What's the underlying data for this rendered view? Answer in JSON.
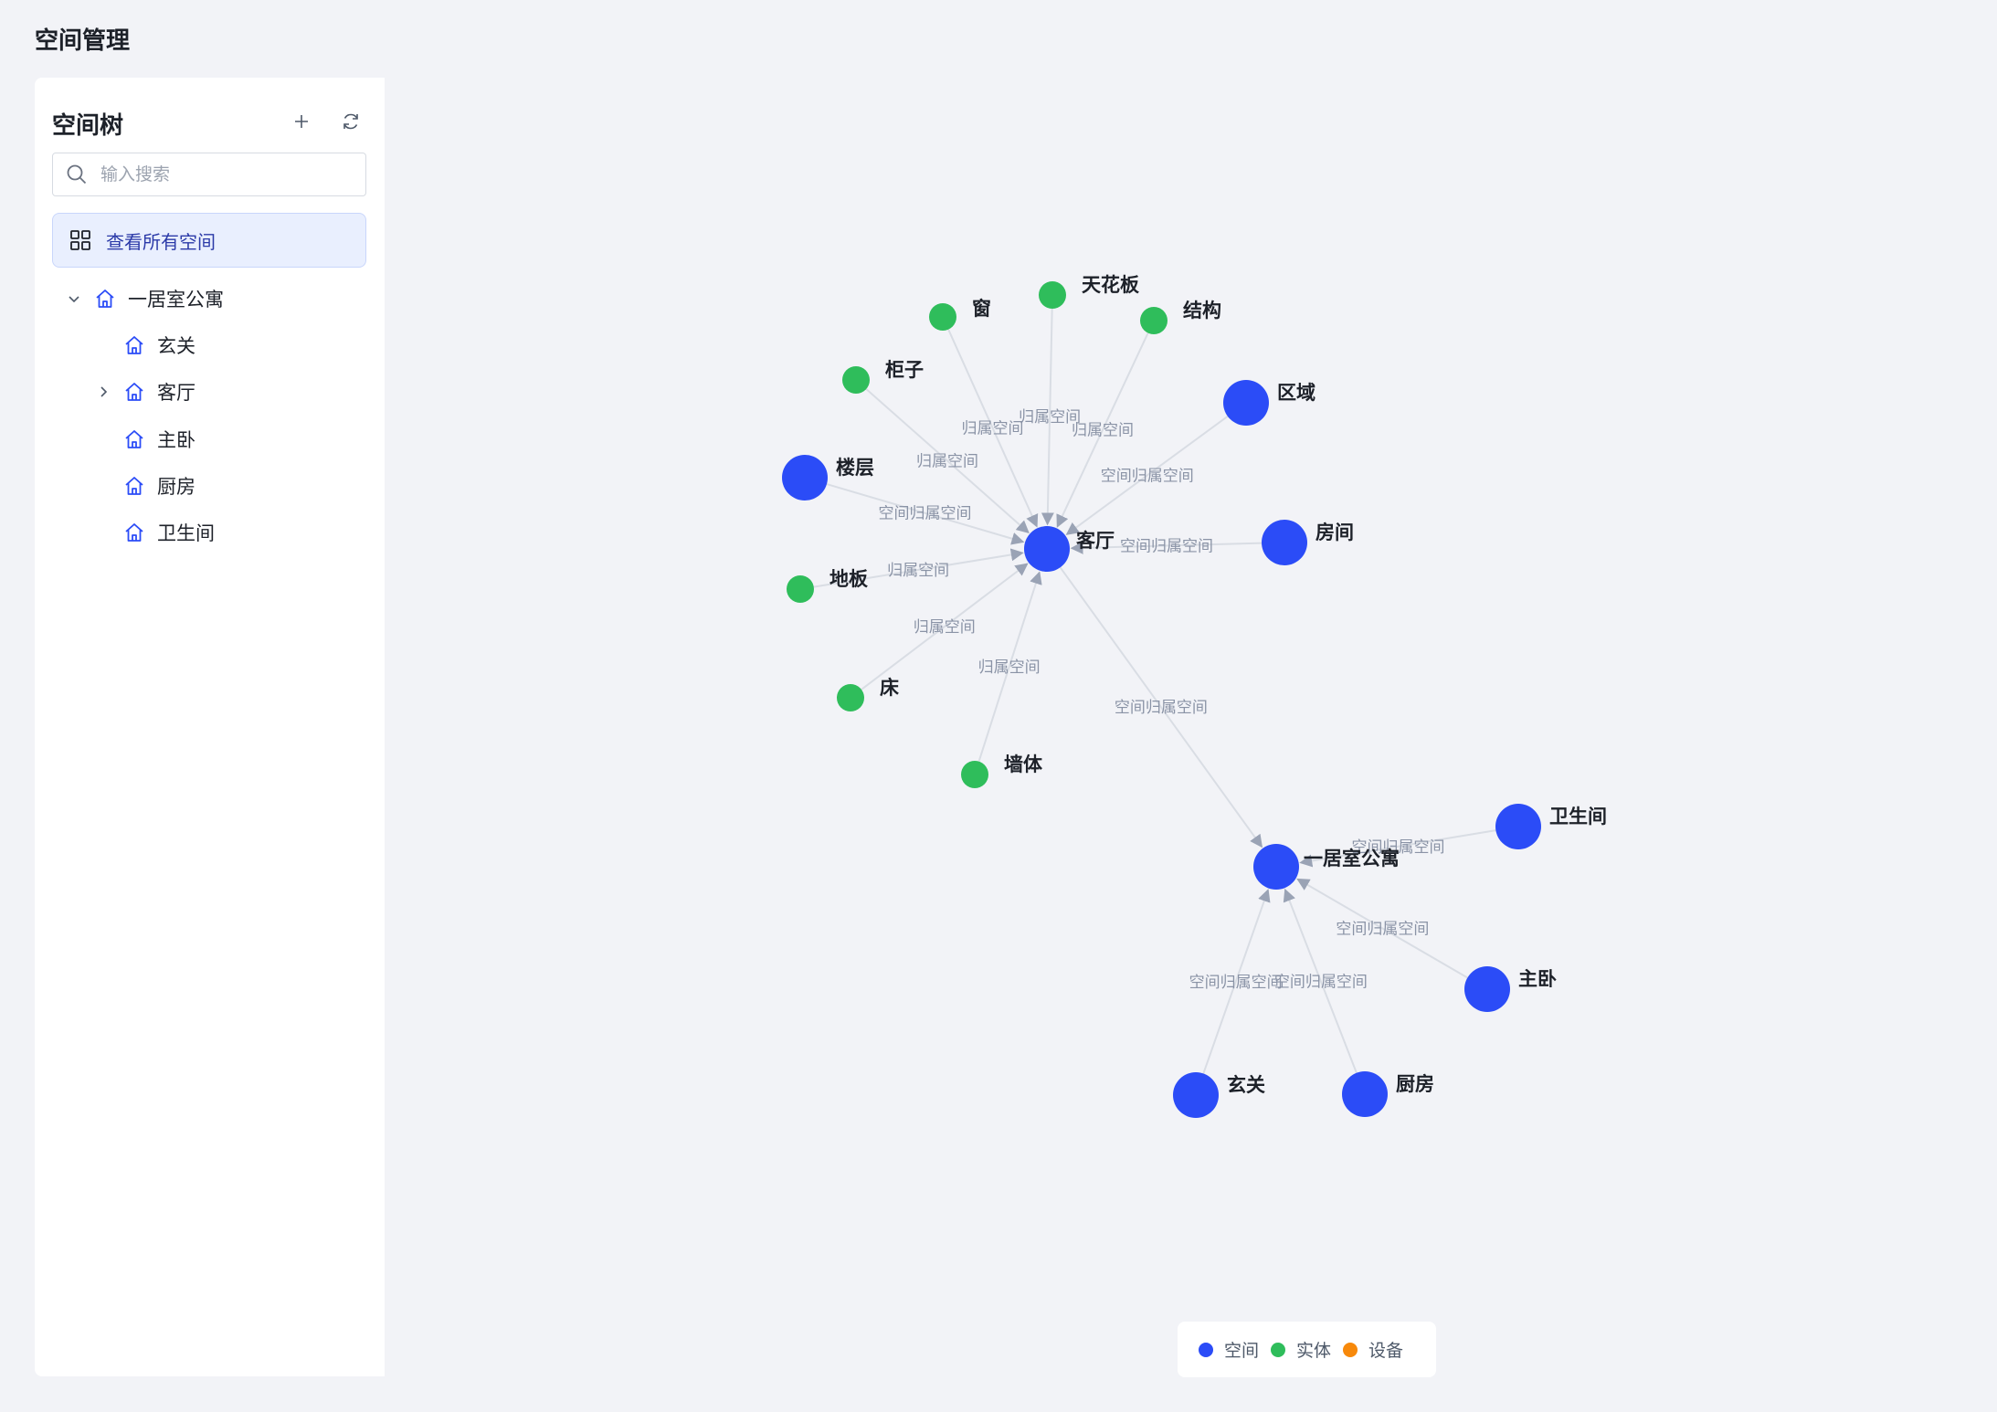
{
  "page": {
    "title": "空间管理"
  },
  "sidebar": {
    "title": "空间树",
    "add_icon": "plus-icon",
    "refresh_icon": "refresh-icon",
    "search": {
      "placeholder": "输入搜索",
      "value": ""
    },
    "view_all_label": "查看所有空间",
    "tree": [
      {
        "label": "一居室公寓",
        "expanded": true,
        "has_children": true,
        "level": 0
      },
      {
        "label": "玄关",
        "has_children": false,
        "level": 1
      },
      {
        "label": "客厅",
        "expanded": false,
        "has_children": true,
        "level": 1
      },
      {
        "label": "主卧",
        "has_children": false,
        "level": 1
      },
      {
        "label": "厨房",
        "has_children": false,
        "level": 1
      },
      {
        "label": "卫生间",
        "has_children": false,
        "level": 1
      }
    ]
  },
  "graph": {
    "colors": {
      "space": "#2b4cf7",
      "entity": "#2fbd5b",
      "device": "#f7890b",
      "edge": "#d9dde4",
      "edge_label": "#8a93a6"
    },
    "nodes": [
      {
        "id": "livingroom",
        "label": "客厅",
        "type": "space"
      },
      {
        "id": "apartment",
        "label": "一居室公寓",
        "type": "space"
      },
      {
        "id": "window",
        "label": "窗",
        "type": "entity"
      },
      {
        "id": "ceiling",
        "label": "天花板",
        "type": "entity"
      },
      {
        "id": "structure",
        "label": "结构",
        "type": "entity"
      },
      {
        "id": "cabinet",
        "label": "柜子",
        "type": "entity"
      },
      {
        "id": "area",
        "label": "区域",
        "type": "space"
      },
      {
        "id": "floorlevel",
        "label": "楼层",
        "type": "space"
      },
      {
        "id": "room",
        "label": "房间",
        "type": "space"
      },
      {
        "id": "floorboard",
        "label": "地板",
        "type": "entity"
      },
      {
        "id": "bed",
        "label": "床",
        "type": "entity"
      },
      {
        "id": "wall",
        "label": "墙体",
        "type": "entity"
      },
      {
        "id": "bathroom",
        "label": "卫生间",
        "type": "space"
      },
      {
        "id": "bedroom",
        "label": "主卧",
        "type": "space"
      },
      {
        "id": "entrance",
        "label": "玄关",
        "type": "space"
      },
      {
        "id": "kitchen",
        "label": "厨房",
        "type": "space"
      }
    ],
    "edges": [
      {
        "from": "window",
        "to": "livingroom",
        "label": "归属空间"
      },
      {
        "from": "ceiling",
        "to": "livingroom",
        "label": "归属空间"
      },
      {
        "from": "structure",
        "to": "livingroom",
        "label": "归属空间"
      },
      {
        "from": "cabinet",
        "to": "livingroom",
        "label": "归属空间"
      },
      {
        "from": "area",
        "to": "livingroom",
        "label": "空间归属空间"
      },
      {
        "from": "floorlevel",
        "to": "livingroom",
        "label": "空间归属空间"
      },
      {
        "from": "room",
        "to": "livingroom",
        "label": "空间归属空间"
      },
      {
        "from": "floorboard",
        "to": "livingroom",
        "label": "归属空间"
      },
      {
        "from": "bed",
        "to": "livingroom",
        "label": "归属空间"
      },
      {
        "from": "wall",
        "to": "livingroom",
        "label": "归属空间"
      },
      {
        "from": "livingroom",
        "to": "apartment",
        "label": "空间归属空间"
      },
      {
        "from": "bathroom",
        "to": "apartment",
        "label": "空间归属空间"
      },
      {
        "from": "bedroom",
        "to": "apartment",
        "label": "空间归属空间"
      },
      {
        "from": "entrance",
        "to": "apartment",
        "label": "空间归属空间"
      },
      {
        "from": "kitchen",
        "to": "apartment",
        "label": "空间归属空间"
      }
    ]
  },
  "legend": [
    {
      "label": "空间",
      "color": "#2b4cf7"
    },
    {
      "label": "实体",
      "color": "#2fbd5b"
    },
    {
      "label": "设备",
      "color": "#f7890b"
    }
  ]
}
